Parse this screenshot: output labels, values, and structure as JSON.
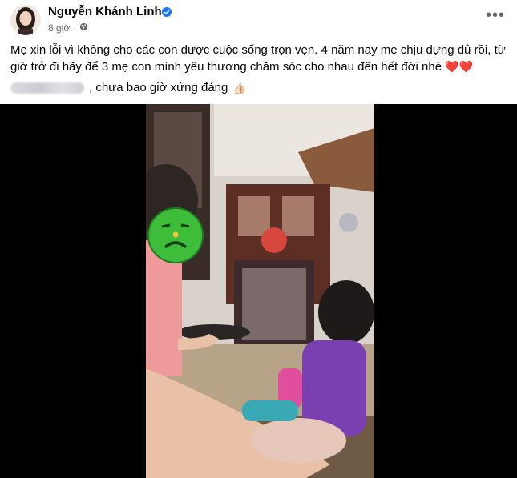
{
  "post": {
    "author": "Nguyễn Khánh Linh",
    "time": "8 giờ",
    "visibility_icon": "globe-icon",
    "verified_icon": "verified-badge-icon",
    "more_icon": "more-horizontal-icon",
    "text_main": "Mẹ xin lỗi vì không cho các con được cuộc sống trọn vẹn. 4 năm nay mẹ chịu đựng đủ rồi, từ giờ trở đi hãy để 3 mẹ con mình yêu thương chăm sóc cho nhau đến hết đời nhé",
    "hearts": "❤️❤️",
    "text_second": ", chưa bao giờ xứng đáng",
    "emoji_thumb": "👍🏻"
  },
  "media": {
    "type": "video-portrait",
    "sticker_icon": "sad-face-sticker-icon"
  },
  "colors": {
    "accent": "#1877f2",
    "sticker": "#3dbd3a",
    "heart": "#e8243d"
  }
}
